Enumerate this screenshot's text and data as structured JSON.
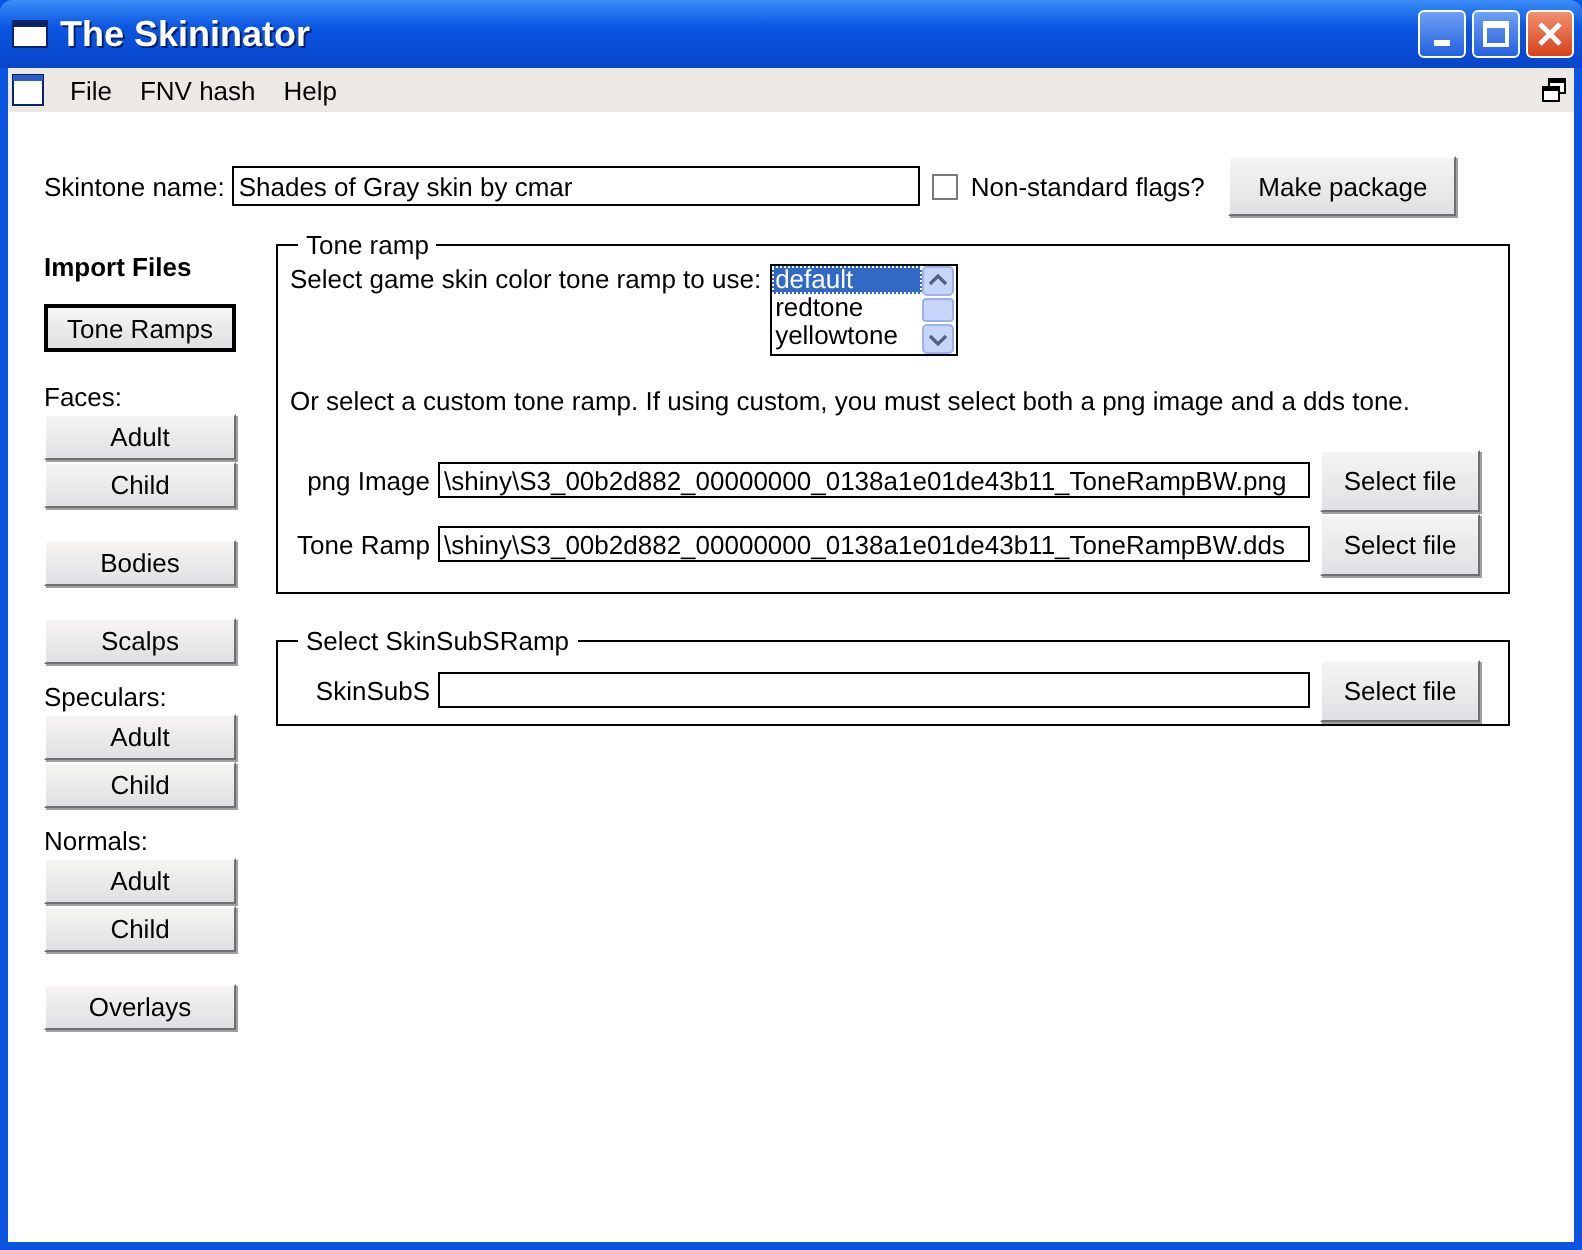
{
  "window": {
    "title": "The Skininator"
  },
  "menu": [
    "File",
    "FNV hash",
    "Help"
  ],
  "skintone": {
    "label": "Skintone name:",
    "value": "Shades of Gray skin by cmar",
    "flags_label": "Non-standard flags?",
    "flags_checked": false,
    "make_button": "Make package"
  },
  "sidebar": {
    "title": "Import Files",
    "groups": [
      {
        "buttons": [
          {
            "label": "Tone Ramps",
            "focused": true
          }
        ]
      },
      {
        "label": "Faces:",
        "buttons": [
          {
            "label": "Adult",
            "focused": false
          },
          {
            "label": "Child",
            "focused": false
          }
        ]
      },
      {
        "buttons": [
          {
            "label": "Bodies",
            "focused": false
          }
        ]
      },
      {
        "buttons": [
          {
            "label": "Scalps",
            "focused": false
          }
        ]
      },
      {
        "label": "Speculars:",
        "buttons": [
          {
            "label": "Adult",
            "focused": false
          },
          {
            "label": "Child",
            "focused": false
          }
        ]
      },
      {
        "label": "Normals:",
        "buttons": [
          {
            "label": "Adult",
            "focused": false
          },
          {
            "label": "Child",
            "focused": false
          }
        ]
      },
      {
        "buttons": [
          {
            "label": "Overlays",
            "focused": false
          }
        ]
      }
    ]
  },
  "tone_ramp": {
    "legend": "Tone ramp",
    "select_label": "Select game skin color tone ramp to use:",
    "options": [
      {
        "label": "default",
        "selected": true
      },
      {
        "label": "redtone",
        "selected": false
      },
      {
        "label": "yellowtone",
        "selected": false
      }
    ],
    "custom_note": "Or select a custom tone ramp. If using custom, you must select both a png image and a dds tone.",
    "files": [
      {
        "label": "png Image",
        "value": "\\shiny\\S3_00b2d882_00000000_0138a1e01de43b11_ToneRampBW.png",
        "button": "Select file"
      },
      {
        "label": "Tone Ramp",
        "value": "\\shiny\\S3_00b2d882_00000000_0138a1e01de43b11_ToneRampBW.dds",
        "button": "Select file"
      }
    ]
  },
  "subs_ramp": {
    "legend": "Select SkinSubSRamp",
    "files": [
      {
        "label": "SkinSubS",
        "button": "Select file"
      }
    ]
  }
}
